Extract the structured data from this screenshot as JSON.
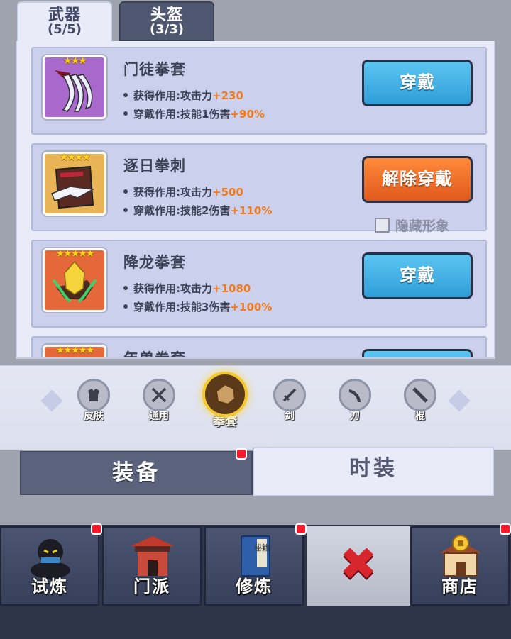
{
  "top_tabs": [
    {
      "label": "武器",
      "count": "(5/5)"
    },
    {
      "label": "头盔",
      "count": "(3/3)"
    }
  ],
  "items": [
    {
      "name": "门徒拳套",
      "stars": "★★★",
      "obtain_label": "获得作用:攻击力",
      "obtain_bonus": "+230",
      "wear_label": "穿戴作用:技能1伤害",
      "wear_bonus": "+90%",
      "button": "穿戴",
      "icon": "claw-icon",
      "frame_color": "#a060c8"
    },
    {
      "name": "逐日拳刺",
      "stars": "★★★★",
      "obtain_label": "获得作用:攻击力",
      "obtain_bonus": "+500",
      "wear_label": "穿戴作用:技能2伤害",
      "wear_bonus": "+110%",
      "button": "解除穿戴",
      "icon": "blade-knuckle-icon",
      "frame_color": "#e0a640",
      "hide_label": "隐藏形象"
    },
    {
      "name": "降龙拳套",
      "stars": "★★★★★",
      "obtain_label": "获得作用:攻击力",
      "obtain_bonus": "+1080",
      "wear_label": "穿戴作用:技能3伤害",
      "wear_bonus": "+100%",
      "button": "穿戴",
      "icon": "dragon-gauntlet-icon",
      "frame_color": "#e0602a"
    },
    {
      "name": "年兽拳套",
      "stars": "★★★★★"
    }
  ],
  "categories": [
    {
      "label": "皮肤",
      "icon": "armor-icon"
    },
    {
      "label": "通用",
      "icon": "crossed-swords-icon"
    },
    {
      "label": "拳套",
      "icon": "fist-icon"
    },
    {
      "label": "剑",
      "icon": "sword-icon"
    },
    {
      "label": "刀",
      "icon": "saber-icon"
    },
    {
      "label": "棍",
      "icon": "staff-icon"
    }
  ],
  "mode_tabs": {
    "equip": "装备",
    "fashion": "时装"
  },
  "nav": [
    {
      "label": "试炼",
      "icon": "ninja-icon"
    },
    {
      "label": "门派",
      "icon": "temple-icon"
    },
    {
      "label": "修炼",
      "icon": "manual-book-icon",
      "book_text": "秘籍"
    },
    {
      "label": "",
      "icon": "close-icon"
    },
    {
      "label": "商店",
      "icon": "shop-icon"
    }
  ],
  "colors": {
    "accent_blue": "#2f9ed8",
    "accent_orange": "#e0591e",
    "bonus": "#f07a1c",
    "notice": "#f01b2c"
  }
}
